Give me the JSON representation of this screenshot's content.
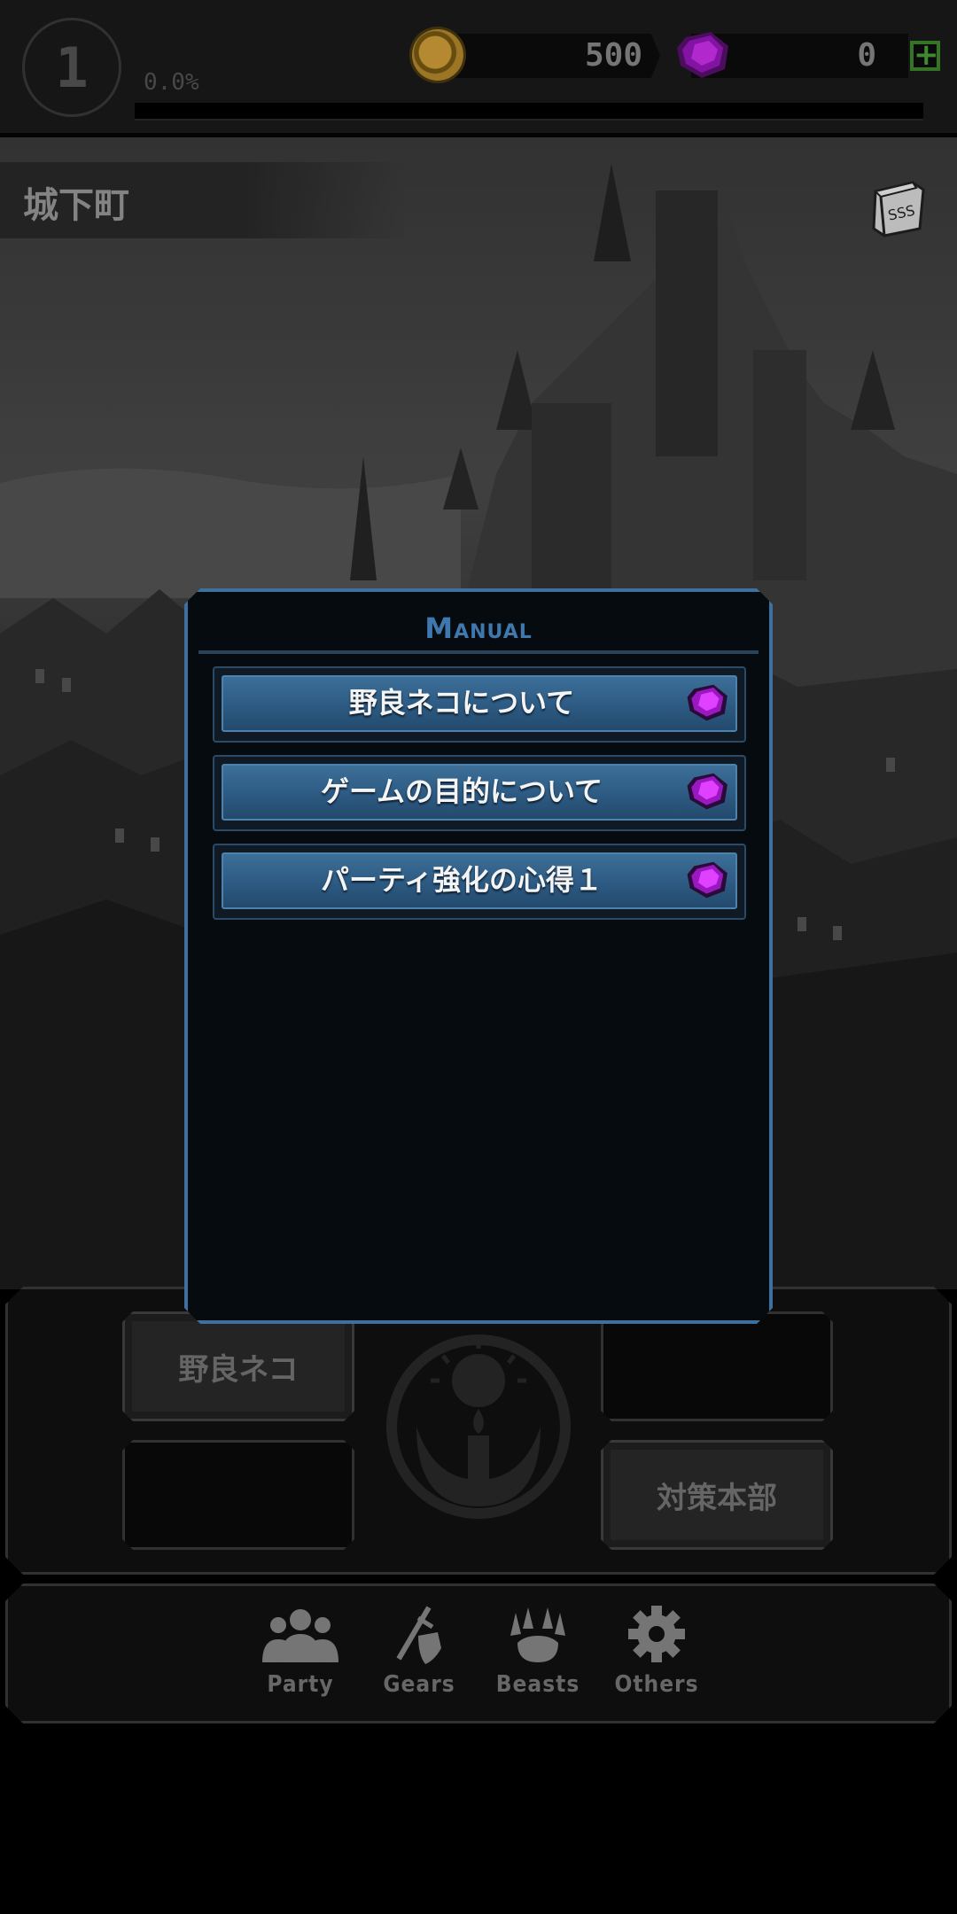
{
  "hud": {
    "level": "1",
    "exp_percent": "0.0%",
    "exp_progress": 0.0,
    "gold": "500",
    "gems": "0"
  },
  "location": {
    "name": "城下町"
  },
  "command_slots": {
    "left_top": "野良ネコ",
    "right_bottom": "対策本部"
  },
  "nav": [
    {
      "label": "Party",
      "icon": "party-icon"
    },
    {
      "label": "Gears",
      "icon": "gears-icon"
    },
    {
      "label": "Beasts",
      "icon": "beasts-icon"
    },
    {
      "label": "Others",
      "icon": "others-icon"
    }
  ],
  "manual": {
    "title": "Manual",
    "items": [
      {
        "label": "野良ネコについて",
        "icon": "gem-icon"
      },
      {
        "label": "ゲームの目的について",
        "icon": "gem-icon"
      },
      {
        "label": "パーティ強化の心得１",
        "icon": "gem-icon"
      }
    ]
  },
  "colors": {
    "accent_blue": "#3f78ad",
    "button_blue": "#2d5a82",
    "gem_purple": "#b020d0",
    "gold": "#d4a23a"
  }
}
